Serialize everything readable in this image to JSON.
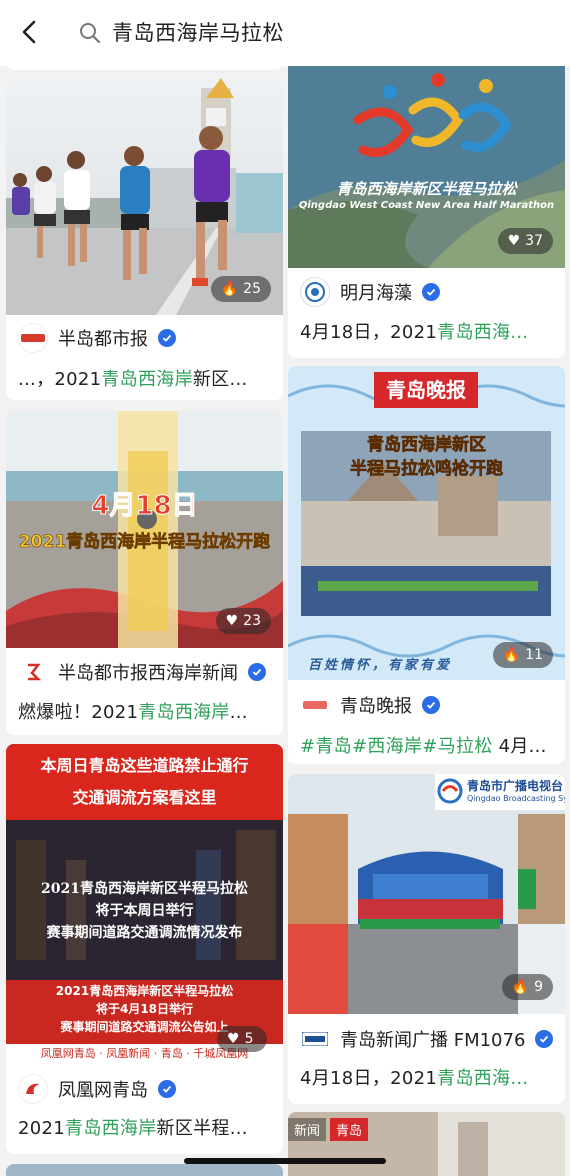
{
  "search": {
    "query": "青岛西海岸马拉松"
  },
  "cards": {
    "c1": {
      "author": "半岛都市报",
      "desc_pre": "...，2021",
      "desc_hl": "青岛西海岸",
      "desc_post": "新区...",
      "likes": "25",
      "like_icon": "fire-icon"
    },
    "c2": {
      "author": "明月海藻",
      "desc_pre": "4月18日，2021",
      "desc_hl": "青岛西海...",
      "desc_post": "",
      "likes": "37",
      "like_icon": "heart-icon",
      "logo_title": "青岛西海岸新区半程马拉松",
      "logo_sub": "Qingdao West Coast New Area Half Marathon"
    },
    "c3": {
      "author": "半岛都市报西海岸新闻",
      "desc_pre": "燃爆啦！2021",
      "desc_hl": "青岛西海岸",
      "desc_post": "...",
      "likes": "23",
      "like_icon": "heart-icon",
      "overlay_date": "4月18日",
      "overlay_title": "2021青岛西海岸半程马拉松开跑"
    },
    "c4": {
      "author": "青岛晚报",
      "desc_pre": "",
      "desc_hl": "#青岛#西海岸#马拉松",
      "desc_post": " 4月...",
      "likes": "11",
      "like_icon": "fire-icon",
      "paper": "青岛晚报",
      "title1": "青岛西海岸新区",
      "title2": "半程马拉松鸣枪开跑",
      "slogan": "百姓情怀，有家有爱"
    },
    "c5": {
      "author": "凤凰网青岛",
      "desc_pre": "2021",
      "desc_hl": "青岛西海岸",
      "desc_post": "新区半程...",
      "likes": "5",
      "like_icon": "heart-icon",
      "banner1": "本周日青岛这些道路禁止通行",
      "banner2": "交通调流方案看这里",
      "mid1": "2021青岛西海岸新区半程马拉松",
      "mid2": "将于本周日举行",
      "mid3": "赛事期间道路交通调流情况发布",
      "low1": "2021青岛西海岸新区半程马拉松",
      "low2": "将于4月18日举行",
      "low3": "赛事期间道路交通调流公告如上",
      "footer": "凤凰网青岛 · 凤凰新闻 · 青岛 · 千城凤凰网"
    },
    "c6": {
      "author": "青岛新闻广播 FM1076",
      "desc_pre": "4月18日，2021",
      "desc_hl": "青岛西海...",
      "desc_post": "",
      "likes": "9",
      "like_icon": "fire-icon",
      "broadcaster": "青岛市广播电视台",
      "broadcaster_en": "Qingdao Broadcasting Syst"
    },
    "c7": {
      "tag1": "新闻",
      "tag2": "青岛"
    }
  },
  "colors": {
    "highlight": "#2ea05a",
    "verify": "#2b6de6"
  }
}
